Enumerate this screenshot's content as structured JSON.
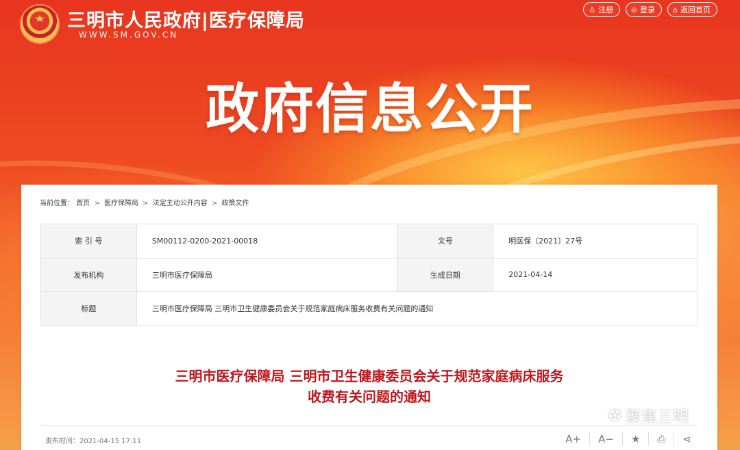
{
  "header": {
    "site_title": "三明市人民政府|医疗保障局",
    "site_url": "WWW.SM.GOV.CN",
    "actions": [
      {
        "icon": "user-icon",
        "glyph": "♙",
        "label": "注册"
      },
      {
        "icon": "login-icon",
        "glyph": "⎆",
        "label": "登录"
      },
      {
        "icon": "home-icon",
        "glyph": "⌂",
        "label": "返回首页"
      }
    ]
  },
  "hero": {
    "title": "政府信息公开"
  },
  "breadcrumb": {
    "prefix": "当前位置：",
    "items": [
      "首页",
      "医疗保障局",
      "法定主动公开内容",
      "政策文件"
    ],
    "separator": ">"
  },
  "info": {
    "index_label": "索 引 号",
    "index_value": "SM00112-0200-2021-00018",
    "doc_no_label": "文号",
    "doc_no_value": "明医保〔2021〕27号",
    "publisher_label": "发布机构",
    "publisher_value": "三明市医疗保障局",
    "date_label": "生成日期",
    "date_value": "2021-04-14",
    "title_label": "标题",
    "title_value": "三明市医疗保障局 三明市卫生健康委员会关于规范家庭病床服务收费有关问题的通知"
  },
  "article": {
    "title_line1": "三明市医疗保障局 三明市卫生健康委员会关于规范家庭病床服务",
    "title_line2": "收费有关问题的通知",
    "publish_time": "发布时间：2021-04-15 17:11"
  },
  "tools": [
    {
      "name": "font-increase-icon",
      "label": "A+"
    },
    {
      "name": "font-decrease-icon",
      "label": "A−"
    },
    {
      "name": "favorite-icon",
      "label": "★"
    },
    {
      "name": "print-icon",
      "label": "⎙"
    },
    {
      "name": "share-icon",
      "label": "⋖"
    }
  ],
  "watermark": {
    "icon": "wechat-icon",
    "text": "聚焦三明"
  },
  "colors": {
    "brand_red": "#e8351f",
    "title_red": "#c0161c"
  }
}
